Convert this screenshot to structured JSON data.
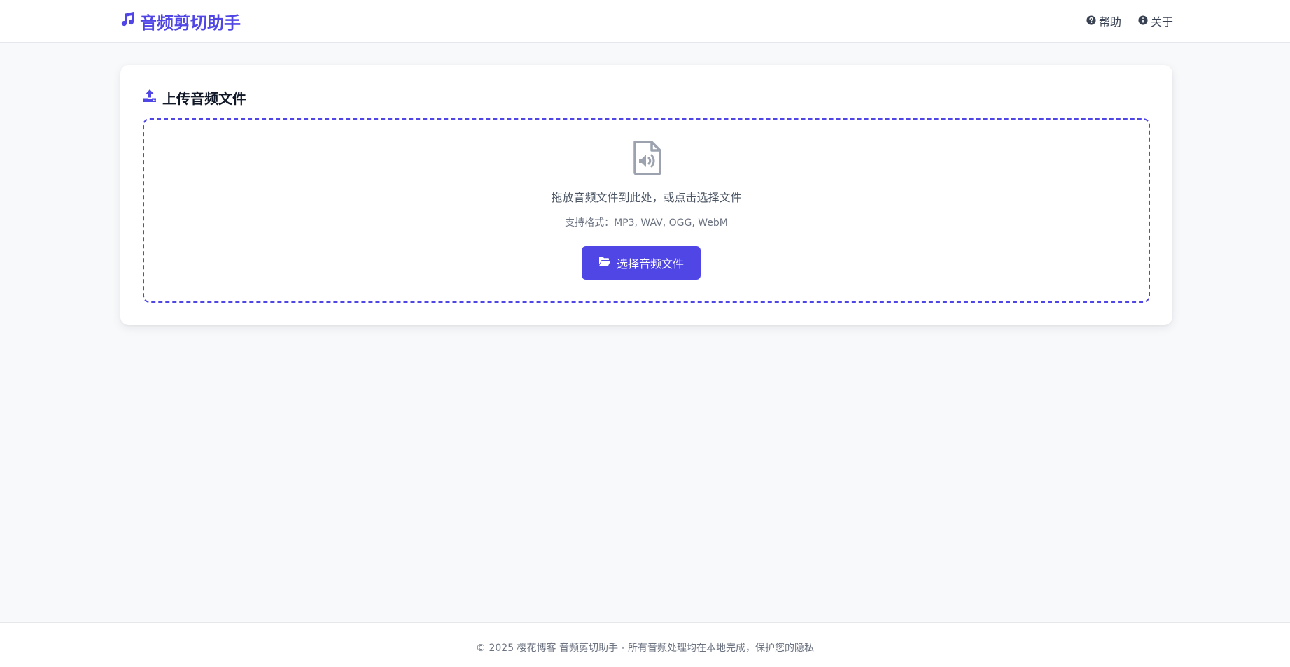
{
  "header": {
    "brand_icon": "music-icon",
    "brand_text": "音频剪切助手",
    "brand_color": "#4f46e5",
    "nav": [
      {
        "icon": "question-circle-icon",
        "label": "帮助"
      },
      {
        "icon": "info-circle-icon",
        "label": "关于"
      }
    ]
  },
  "upload": {
    "icon": "upload-icon",
    "title": "上传音频文件",
    "dropzone": {
      "icon": "audio-file-icon",
      "main_text": "拖放音频文件到此处，或点击选择文件",
      "formats_text": "支持格式：MP3, WAV, OGG, WebM"
    },
    "button": {
      "icon": "folder-open-icon",
      "label": "选择音频文件"
    }
  },
  "footer": {
    "text": "© 2025 樱花博客 音频剪切助手 - 所有音频处理均在本地完成，保护您的隐私"
  },
  "colors": {
    "accent": "#4f46e5",
    "background": "#f8f9fb",
    "surface": "#ffffff"
  }
}
